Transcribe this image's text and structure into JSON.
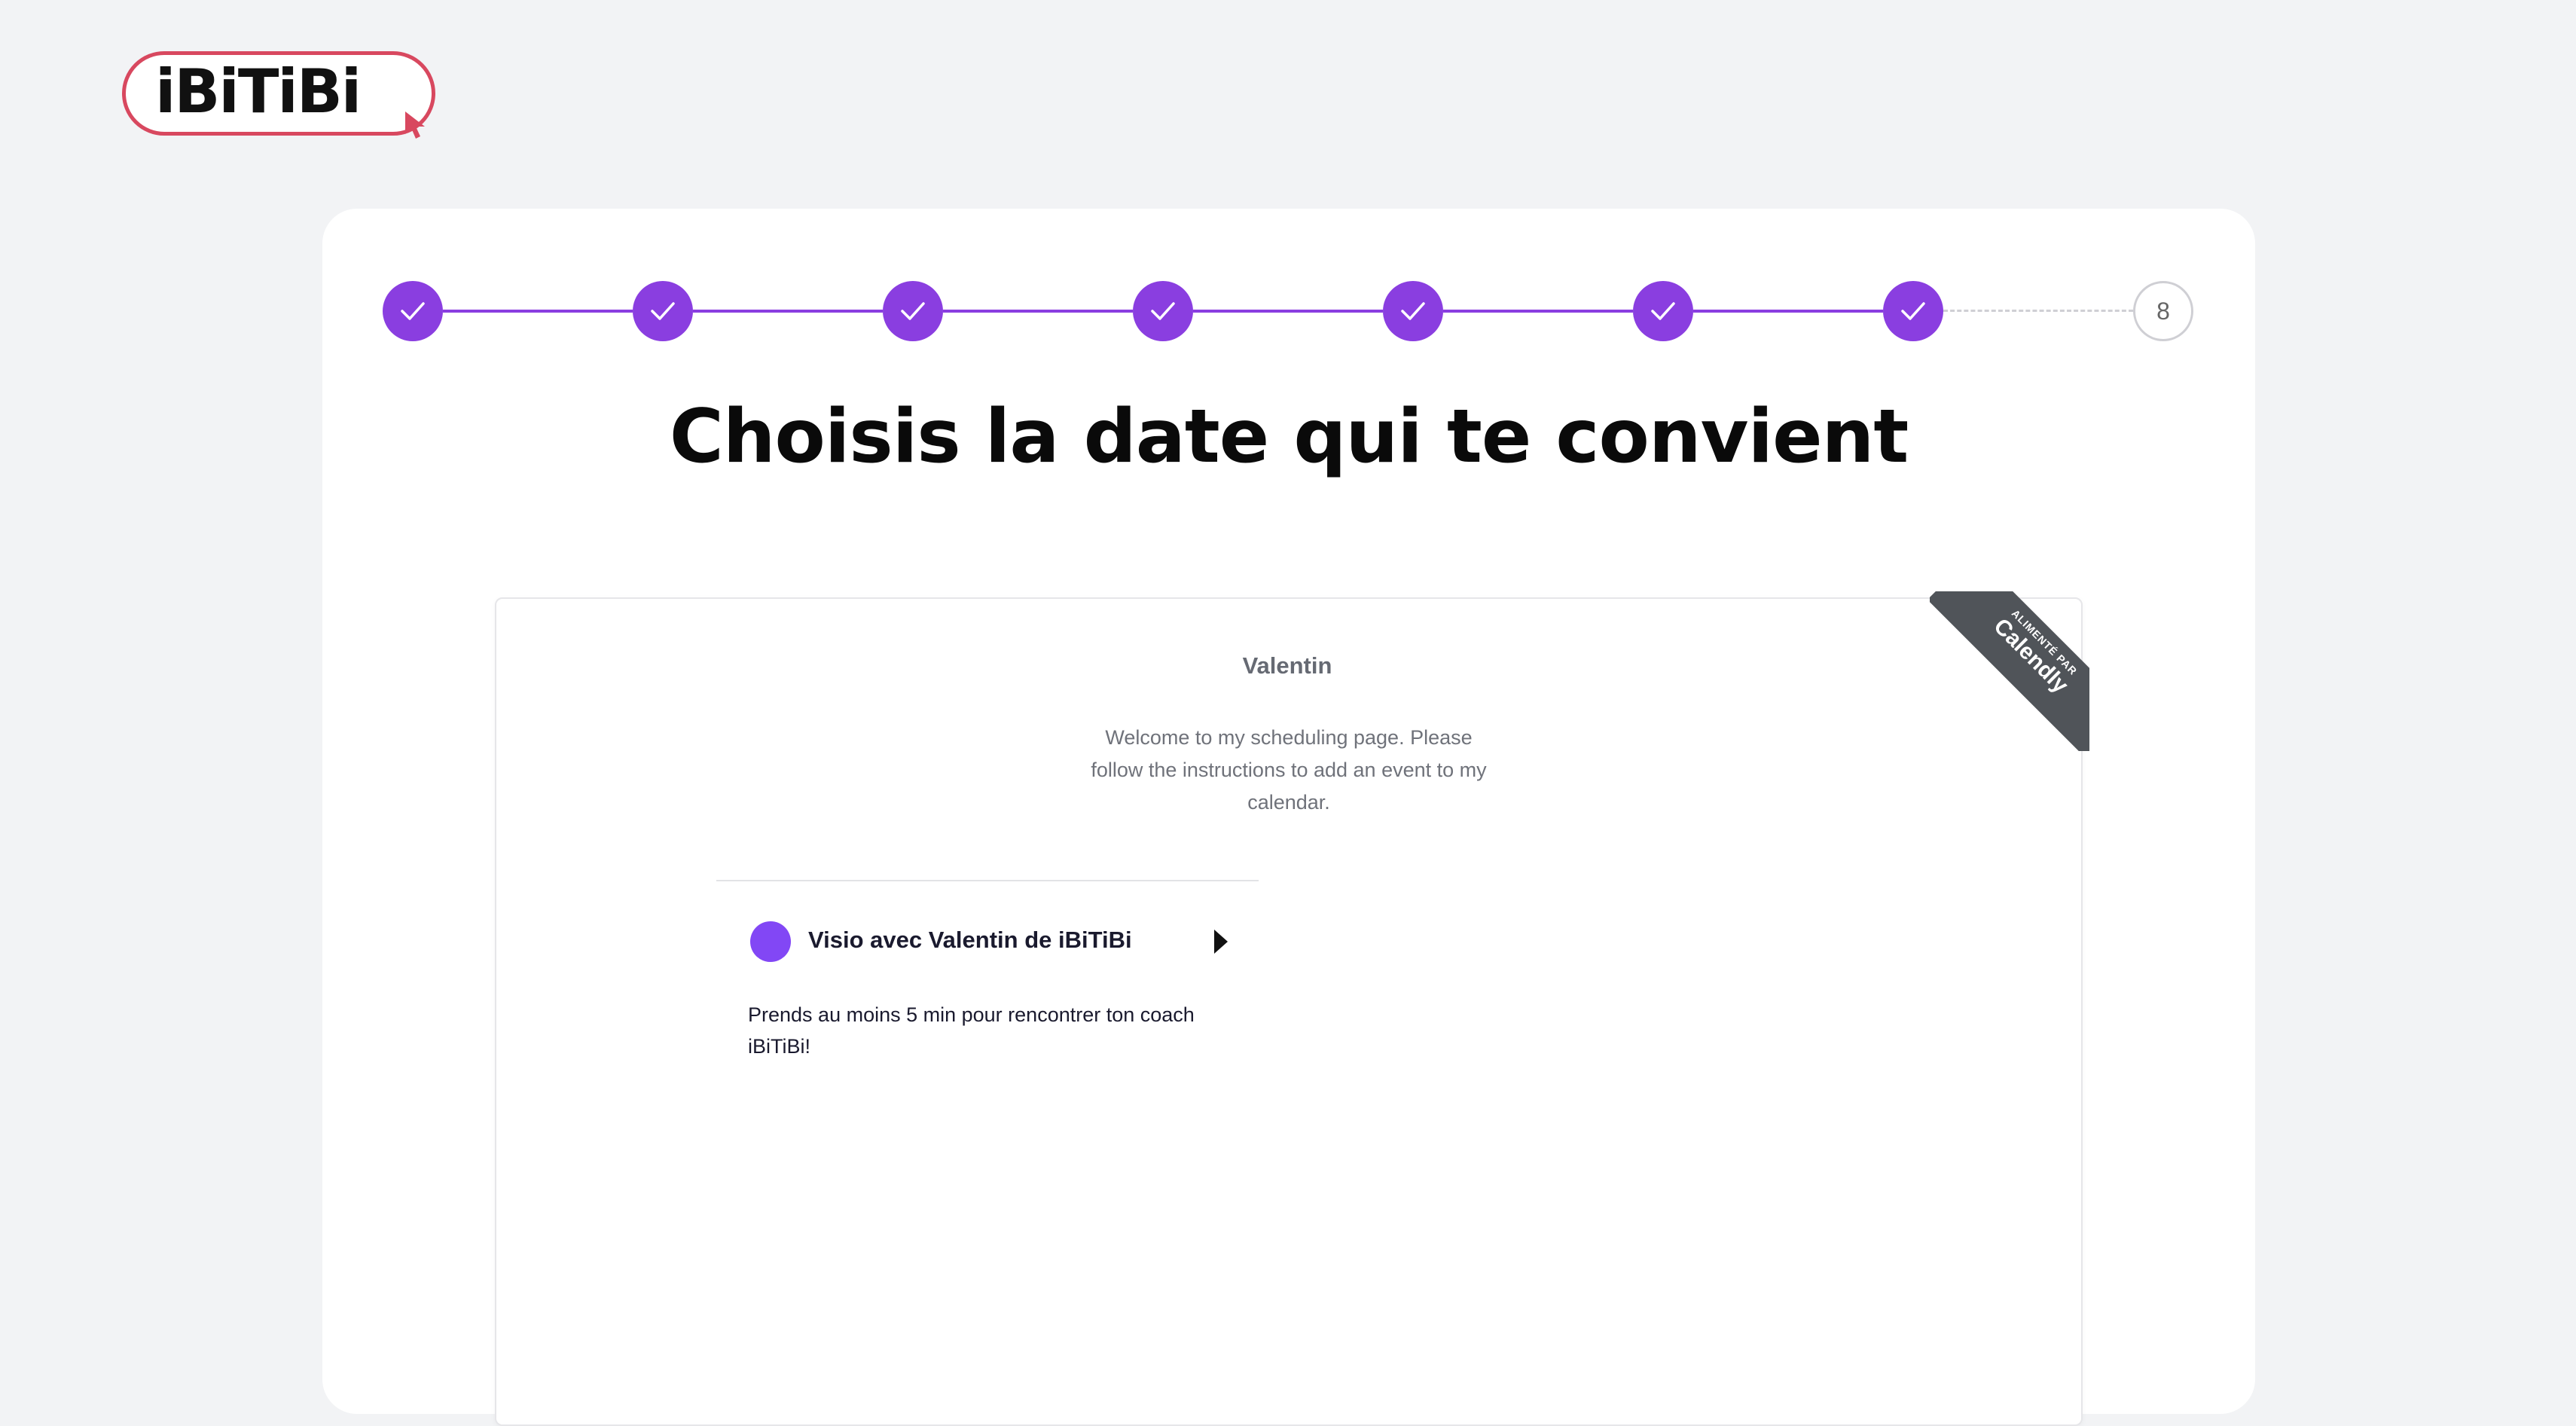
{
  "brand": {
    "logo_text": "iBiTiBi",
    "accent_color": "#8a3ee0",
    "logo_border_color": "#d8485f"
  },
  "stepper": {
    "steps": [
      {
        "state": "done",
        "icon": "check-icon"
      },
      {
        "state": "done",
        "icon": "check-icon"
      },
      {
        "state": "done",
        "icon": "check-icon"
      },
      {
        "state": "done",
        "icon": "check-icon"
      },
      {
        "state": "done",
        "icon": "check-icon"
      },
      {
        "state": "done",
        "icon": "check-icon"
      },
      {
        "state": "done",
        "icon": "check-icon"
      },
      {
        "state": "pending",
        "label": "8"
      }
    ]
  },
  "page": {
    "title": "Choisis la date qui te convient"
  },
  "calendly": {
    "badge_small": "ALIMENTÉ PAR",
    "badge_big": "Calendly",
    "host_name": "Valentin",
    "host_description": "Welcome to my scheduling page. Please follow the instructions to add an event to my calendar.",
    "event": {
      "name": "Visio avec Valentin de iBiTiBi",
      "color": "#8247f5",
      "description": "Prends au moins 5 min pour rencontrer ton coach iBiTiBi!"
    }
  }
}
